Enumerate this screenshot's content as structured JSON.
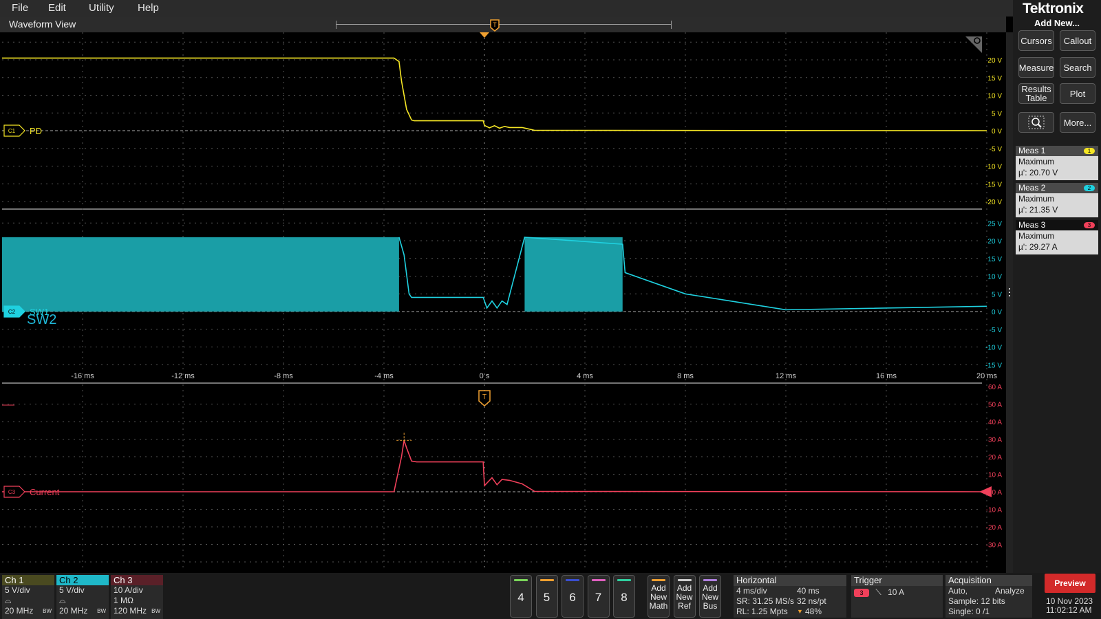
{
  "menu": [
    "File",
    "Edit",
    "Utility",
    "Help"
  ],
  "waveform_view": {
    "title": "Waveform View",
    "trigger_marker": "T",
    "ch1_label": "PD",
    "ch2_label": "SW1",
    "ch2_overlay_label": "SW2",
    "ch3_label": "Current",
    "ch1_tag": "C1",
    "ch2_tag": "C2",
    "ch3_tag": "C3",
    "time_ticks": [
      "-16 ms",
      "-12 ms",
      "-8 ms",
      "-4 ms",
      "0 s",
      "4 ms",
      "8 ms",
      "12 ms",
      "16 ms",
      "20 ms"
    ],
    "ch1_ticks": [
      "20 V",
      "15 V",
      "10 V",
      "5 V",
      "0 V",
      "-5 V",
      "-10 V",
      "-15 V",
      "-20 V"
    ],
    "ch2_ticks": [
      "25 V",
      "20 V",
      "15 V",
      "10 V",
      "5 V",
      "0 V",
      "-5 V",
      "-10 V",
      "-15 V"
    ],
    "ch3_ticks": [
      "60 A",
      "50 A",
      "40 A",
      "30 A",
      "20 A",
      "10 A",
      "0 A",
      "-10 A",
      "-20 A",
      "-30 A"
    ]
  },
  "right_panel": {
    "logo": "Tektronix",
    "add_new": "Add New...",
    "buttons": {
      "cursors": "Cursors",
      "callout": "Callout",
      "measure": "Measure",
      "search": "Search",
      "results_line1": "Results",
      "results_line2": "Table",
      "plot": "Plot",
      "more": "More..."
    },
    "measurements": [
      {
        "title": "Meas 1",
        "badge": "1",
        "type": "Maximum",
        "value": "µ': 20.70 V",
        "color": "#f5e625"
      },
      {
        "title": "Meas 2",
        "badge": "2",
        "type": "Maximum",
        "value": "µ': 21.35 V",
        "color": "#1fd1e0"
      },
      {
        "title": "Meas 3",
        "badge": "3",
        "type": "Maximum",
        "value": "µ': 29.27 A",
        "color": "#f0405a"
      }
    ]
  },
  "channels": [
    {
      "name": "Ch 1",
      "scale": "5 V/div",
      "line3": "20 MHz",
      "bw": "BW",
      "color": "#d8c820",
      "headbg": "#4a4a20"
    },
    {
      "name": "Ch 2",
      "scale": "5 V/div",
      "line3": "20 MHz",
      "bw": "BW",
      "color": "#1fd1e0",
      "headbg": "#1fb8c8"
    },
    {
      "name": "Ch 3",
      "scale": "10 A/div",
      "line2": "1 MΩ",
      "line3": "120 MHz",
      "bw": "BW",
      "color": "#f0405a",
      "headbg": "#5a2028"
    }
  ],
  "math_buttons": [
    {
      "label": "4",
      "color": "#7bd65a"
    },
    {
      "label": "5",
      "color": "#f0a030"
    },
    {
      "label": "6",
      "color": "#3a4fd0"
    },
    {
      "label": "7",
      "color": "#e060c0"
    },
    {
      "label": "8",
      "color": "#30d0a0"
    }
  ],
  "add_buttons": [
    {
      "l1": "Add",
      "l2": "New",
      "l3": "Math",
      "color": "#f0a030"
    },
    {
      "l1": "Add",
      "l2": "New",
      "l3": "Ref",
      "color": "#cfcfcf"
    },
    {
      "l1": "Add",
      "l2": "New",
      "l3": "Bus",
      "color": "#b080e0"
    }
  ],
  "horizontal": {
    "title": "Horizontal",
    "scale": "4 ms/div",
    "duration": "40 ms",
    "sr": "SR: 31.25 MS/s",
    "pt": "32 ns/pt",
    "rl": "RL: 1.25 Mpts",
    "pos": "48%"
  },
  "trigger": {
    "title": "Trigger",
    "source": "3",
    "level": "10 A"
  },
  "acquisition": {
    "title": "Acquisition",
    "mode": "Auto,",
    "analyze": "Analyze",
    "sample": "Sample: 12 bits",
    "single": "Single: 0 /1"
  },
  "preview": "Preview",
  "date": "10 Nov 2023",
  "time": "11:02:12 AM",
  "chart_data": {
    "type": "line",
    "x_unit": "ms",
    "xlim": [
      -20,
      20
    ],
    "trigger_position_x": 0,
    "series": [
      {
        "name": "PD",
        "unit": "V",
        "ylim": [
          -20,
          20
        ],
        "x": [
          -20,
          -3.6,
          -3.4,
          -3.3,
          -3.1,
          -2.9,
          -2.8,
          -0.05,
          0.0,
          0.2,
          0.4,
          0.6,
          0.8,
          1.0,
          1.5,
          2.0,
          20
        ],
        "y": [
          20.5,
          20.5,
          19.5,
          14,
          6,
          3,
          2.8,
          2.8,
          1.5,
          0.8,
          1.4,
          0.7,
          1.2,
          0.9,
          0.9,
          0.1,
          0.0
        ]
      },
      {
        "name": "SW1",
        "unit": "V",
        "ylim": [
          -20,
          25
        ],
        "switching_bursts": [
          [
            -20,
            -3.4,
            21
          ],
          [
            1.6,
            5.5,
            21
          ]
        ],
        "x": [
          -3.4,
          -3.2,
          -3.0,
          -2.9,
          -0.05,
          0.1,
          0.3,
          0.5,
          0.7,
          0.9,
          1.6,
          5.5,
          5.6,
          8,
          12,
          20
        ],
        "y": [
          21,
          16,
          5,
          4,
          4,
          1,
          3,
          1,
          3,
          2,
          21,
          19,
          11,
          5,
          0.5,
          1.5
        ]
      },
      {
        "name": "Current",
        "unit": "A",
        "ylim": [
          -30,
          60
        ],
        "x": [
          -20,
          -3.6,
          -3.3,
          -3.2,
          -3.1,
          -2.9,
          -2.7,
          -0.05,
          0.0,
          0.3,
          0.5,
          0.7,
          1.0,
          1.5,
          2.0,
          20
        ],
        "y": [
          0,
          0,
          20,
          29.3,
          25,
          17.5,
          17,
          17,
          3.5,
          8,
          4,
          7,
          6.5,
          4.5,
          0.2,
          0
        ]
      }
    ]
  }
}
